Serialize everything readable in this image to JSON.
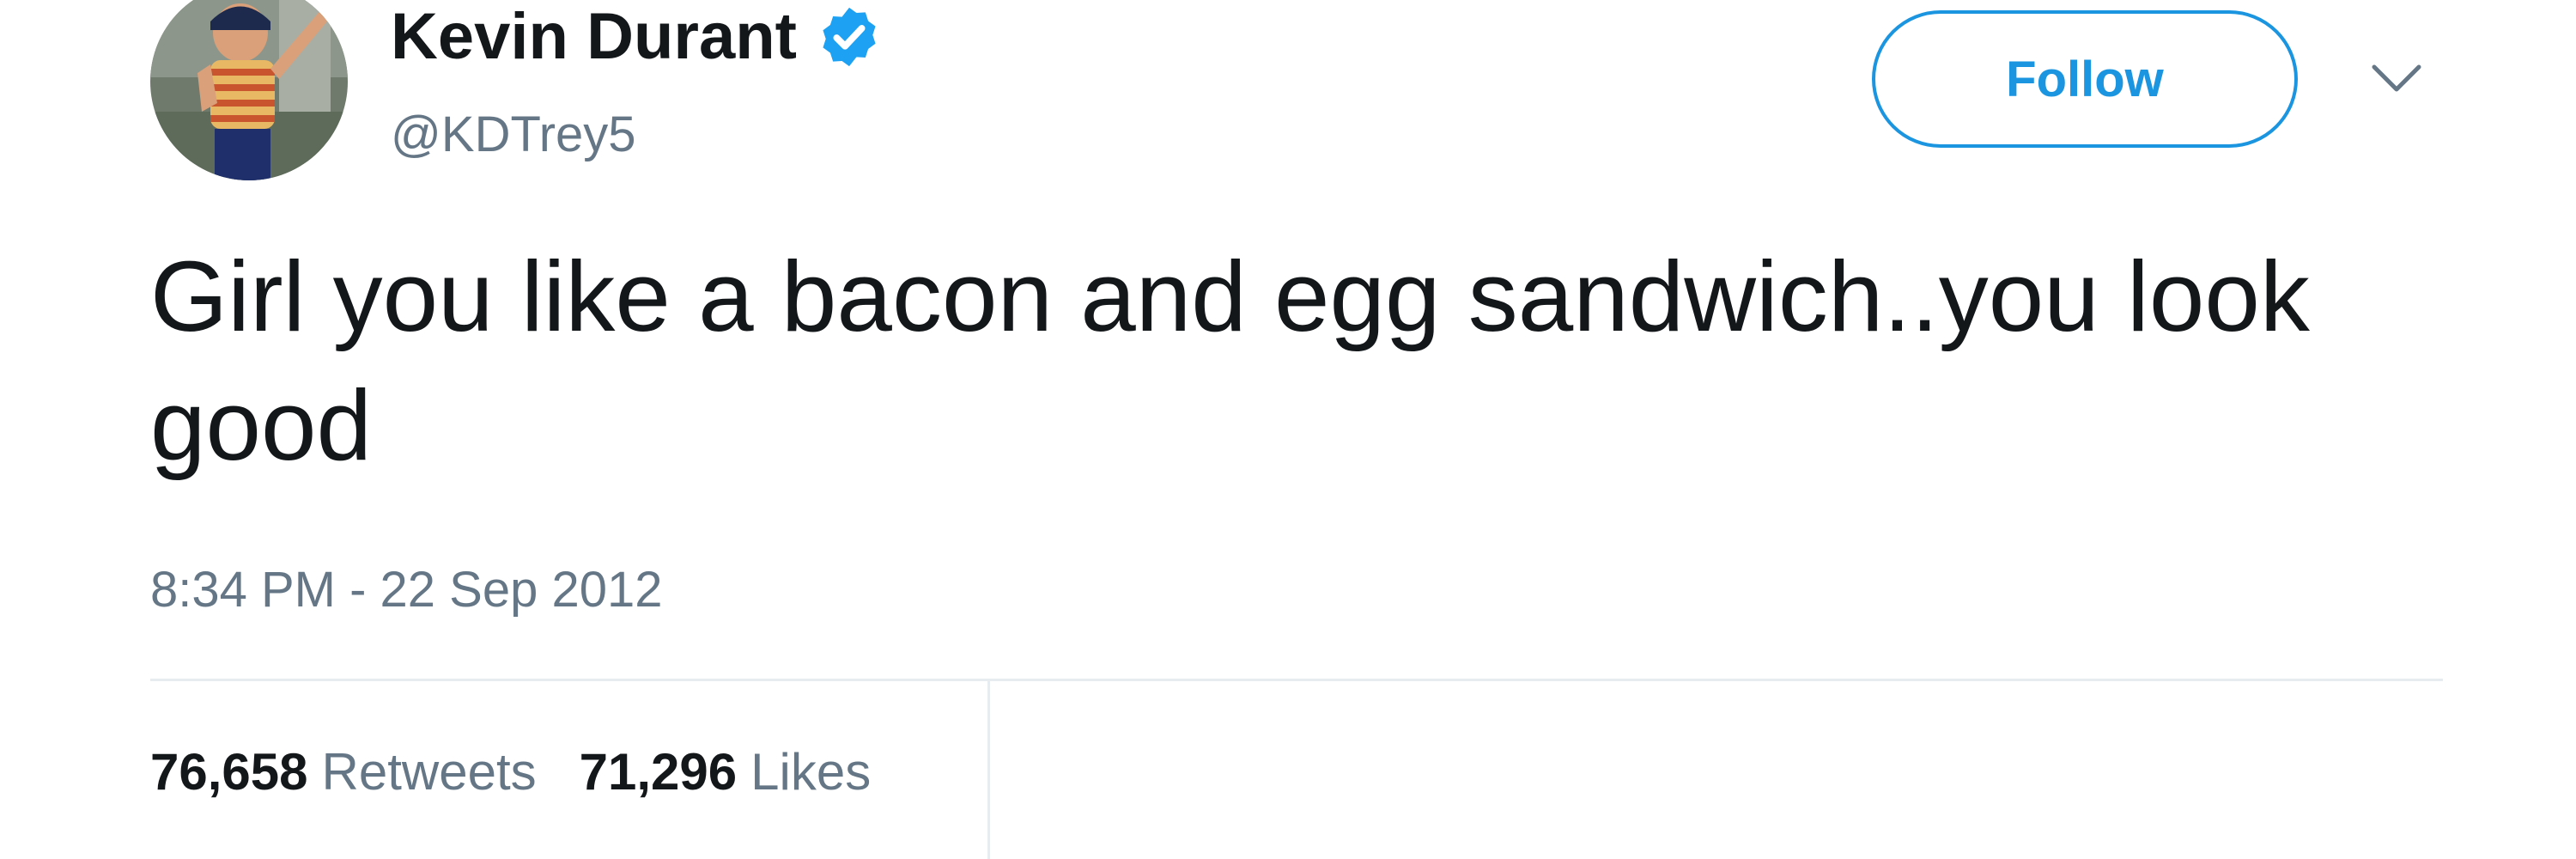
{
  "user": {
    "display_name": "Kevin Durant",
    "handle": "@KDTrey5",
    "verified": true,
    "avatar_icon": "user-photo-avatar"
  },
  "actions": {
    "follow_label": "Follow",
    "menu_icon": "chevron-down-icon"
  },
  "tweet": {
    "text": "Girl you like a bacon and egg sandwich..you look good",
    "timestamp": "8:34 PM - 22 Sep 2012"
  },
  "stats": {
    "retweets_count": "76,658",
    "retweets_label": "Retweets",
    "likes_count": "71,296",
    "likes_label": "Likes"
  },
  "colors": {
    "accent": "#1b95e0",
    "verified": "#1da1f2",
    "text_primary": "#14171a",
    "text_secondary": "#657786",
    "divider": "#e6ecf0"
  }
}
